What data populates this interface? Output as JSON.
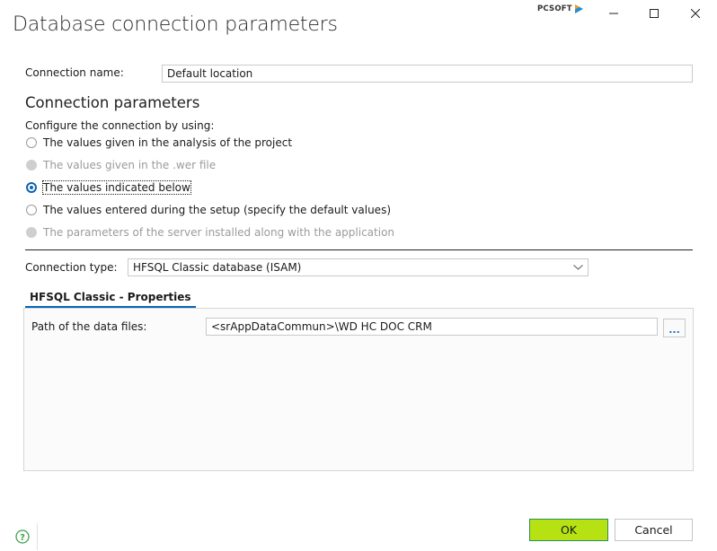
{
  "window": {
    "title": "Database connection parameters",
    "brand": "PCSOFT",
    "controls": [
      "minimize",
      "maximize",
      "close"
    ]
  },
  "connection_name": {
    "label": "Connection name:",
    "value": "Default location"
  },
  "connection_parameters": {
    "heading": "Connection parameters",
    "configure_label": "Configure the connection by using:",
    "options": [
      {
        "label": "The values given in the analysis of the project",
        "state": "enabled",
        "checked": false
      },
      {
        "label": "The values given in the .wer file",
        "state": "disabled",
        "checked": false
      },
      {
        "label": "The values indicated below",
        "state": "enabled",
        "checked": true
      },
      {
        "label": "The values entered during the setup (specify the default values)",
        "state": "enabled",
        "checked": false
      },
      {
        "label": "The parameters of the server installed along with the application",
        "state": "disabled",
        "checked": false
      }
    ]
  },
  "connection_type": {
    "label": "Connection type:",
    "selected": "HFSQL Classic database (ISAM)"
  },
  "properties": {
    "tab_label": "HFSQL Classic - Properties",
    "path_label": "Path of the data files:",
    "path_value": "<srAppDataCommun>\\WD HC DOC CRM",
    "browse_label": "..."
  },
  "footer": {
    "ok_label": "OK",
    "cancel_label": "Cancel"
  },
  "colors": {
    "accent": "#0b63b4",
    "ok_button": "#b6e213",
    "help_icon": "#3fa34d"
  }
}
